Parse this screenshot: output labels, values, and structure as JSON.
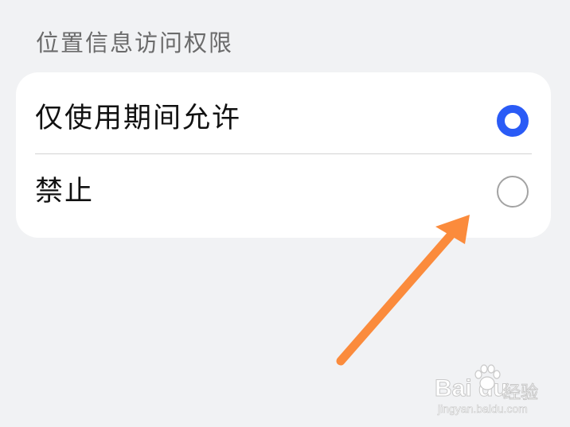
{
  "section": {
    "title": "位置信息访问权限"
  },
  "options": [
    {
      "label": "仅使用期间允许",
      "selected": true
    },
    {
      "label": "禁止",
      "selected": false
    }
  ],
  "colors": {
    "accent": "#2a5bf6",
    "annotation_arrow": "#fb8b3c",
    "background": "#f1f2f4",
    "card": "#ffffff"
  },
  "annotation": {
    "icon": "arrow-pointer-icon"
  },
  "watermark": {
    "logo": "Bai du",
    "suffix": "经验",
    "url": "jingyan.baidu.com"
  }
}
